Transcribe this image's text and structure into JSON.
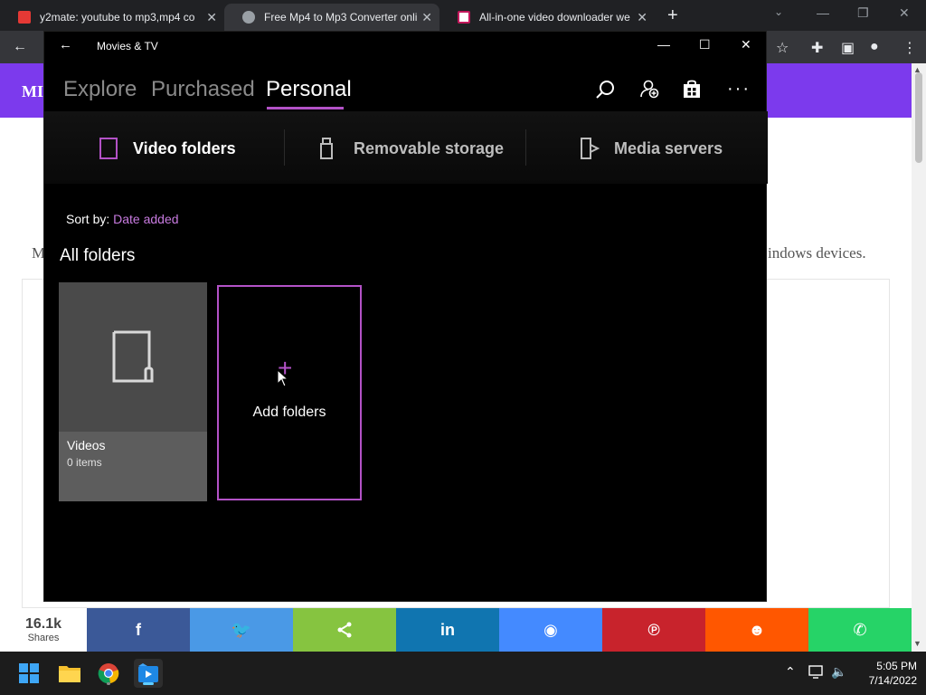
{
  "browser": {
    "tabs": [
      {
        "title": "y2mate: youtube to mp3,mp4 co",
        "active": false
      },
      {
        "title": "Free Mp4 to Mp3 Converter onli",
        "active": true
      },
      {
        "title": "All-in-one video downloader we",
        "active": false
      }
    ],
    "newtab": "+"
  },
  "webpage": {
    "logo": "MI",
    "text_left": "M",
    "text_right": "indows devices."
  },
  "share": {
    "count": "16.1k",
    "count_label": "Shares",
    "buttons": [
      {
        "icon": "facebook-icon",
        "glyph": "f",
        "color": "#3b5998"
      },
      {
        "icon": "twitter-icon",
        "glyph": "🐦",
        "color": "#4a99e6"
      },
      {
        "icon": "share-icon",
        "glyph": "⟨",
        "color": "#86c440"
      },
      {
        "icon": "linkedin-icon",
        "glyph": "in",
        "color": "#1075b0"
      },
      {
        "icon": "messenger-icon",
        "glyph": "◉",
        "color": "#448aff"
      },
      {
        "icon": "pinterest-icon",
        "glyph": "℗",
        "color": "#c8232c"
      },
      {
        "icon": "reddit-icon",
        "glyph": "☻",
        "color": "#ff5700"
      },
      {
        "icon": "whatsapp-icon",
        "glyph": "✆",
        "color": "#26d367"
      }
    ]
  },
  "app": {
    "title": "Movies & TV",
    "nav": {
      "tabs": [
        "Explore",
        "Purchased",
        "Personal"
      ],
      "active": "Personal"
    },
    "categories": [
      "Video folders",
      "Removable storage",
      "Media servers"
    ],
    "sort": {
      "label": "Sort by:",
      "value": "Date added"
    },
    "section_title": "All folders",
    "tiles": {
      "videos": {
        "name": "Videos",
        "count": "0 items"
      },
      "add": {
        "label": "Add folders"
      }
    },
    "accent": "#b352c7"
  },
  "taskbar": {
    "time": "5:05 PM",
    "date": "7/14/2022"
  }
}
